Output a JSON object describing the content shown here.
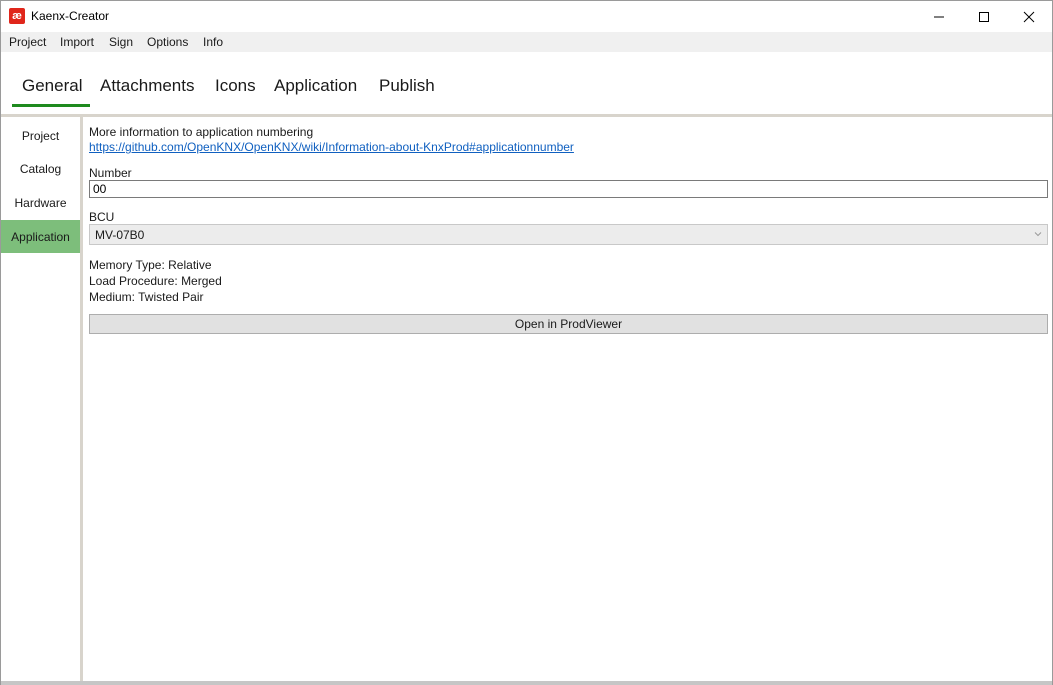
{
  "window": {
    "title": "Kaenx-Creator",
    "app_icon_glyph": "æ",
    "app_icon_color": "#e0261b"
  },
  "menu": [
    "Project",
    "Import",
    "Sign",
    "Options",
    "Info"
  ],
  "tabs": {
    "items": [
      "General",
      "Attachments",
      "Icons",
      "Application",
      "Publish"
    ],
    "active": "General",
    "accent": "#1e8a1e"
  },
  "sidenav": {
    "items": [
      "Project",
      "Catalog",
      "Hardware",
      "Application"
    ],
    "active": "Application",
    "active_color": "#7dbe7b"
  },
  "main": {
    "info_label": "More information to application numbering",
    "info_link": "https://github.com/OpenKNX/OpenKNX/wiki/Information-about-KnxProd#applicationnumber",
    "number_label": "Number",
    "number_value": "00",
    "bcu_label": "BCU",
    "bcu_value": "MV-07B0",
    "memory_type": "Memory Type: Relative",
    "load_procedure": "Load Procedure: Merged",
    "medium": "Medium: Twisted Pair",
    "open_button": "Open in ProdViewer"
  },
  "icons": {
    "minimize": "minimize-icon",
    "maximize": "maximize-icon",
    "close": "close-icon",
    "dropdown": "chevron-down-icon"
  }
}
